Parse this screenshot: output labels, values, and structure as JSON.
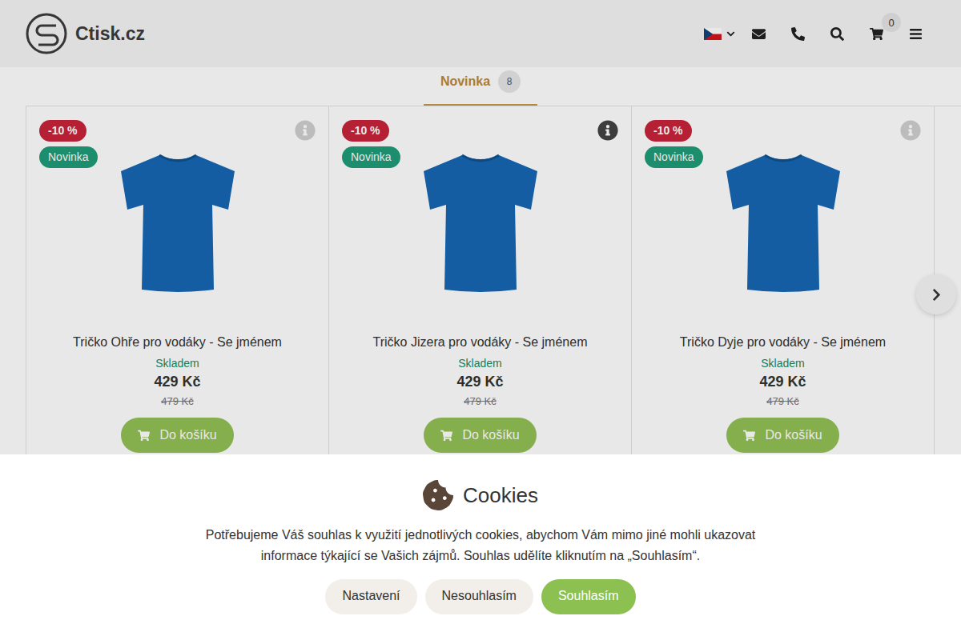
{
  "header": {
    "logo": "Ctisk.cz",
    "cart_count": "0"
  },
  "tabs": [
    {
      "label": "Novinka",
      "count": "8",
      "selected": true
    }
  ],
  "products": [
    {
      "name": "Tričko Ohře pro vodáky - Se jménem",
      "discount": "-10 %",
      "badge": "Novinka",
      "stock": "Skladem",
      "price": "429 Kč",
      "old_price": "479 Kč",
      "button": "Do košíku",
      "info_highlighted": false
    },
    {
      "name": "Tričko Jizera pro vodáky - Se jménem",
      "discount": "-10 %",
      "badge": "Novinka",
      "stock": "Skladem",
      "price": "429 Kč",
      "old_price": "479 Kč",
      "button": "Do košíku",
      "info_highlighted": true
    },
    {
      "name": "Tričko Dyje pro vodáky - Se jménem",
      "discount": "-10 %",
      "badge": "Novinka",
      "stock": "Skladem",
      "price": "429 Kč",
      "old_price": "479 Kč",
      "button": "Do košíku",
      "info_highlighted": false
    }
  ],
  "cookies": {
    "title": "Cookies",
    "text": "Potřebujeme Váš souhlas k využití jednotlivých cookies, abychom Vám mimo jiné mohli ukazovat informace týkající se Vašich zájmů. Souhlas udělíte kliknutím na „Souhlasím“.",
    "buttons": [
      {
        "label": "Nastavení",
        "primary": false
      },
      {
        "label": "Nesouhlasím",
        "primary": false
      },
      {
        "label": "Souhlasím",
        "primary": true
      }
    ]
  }
}
